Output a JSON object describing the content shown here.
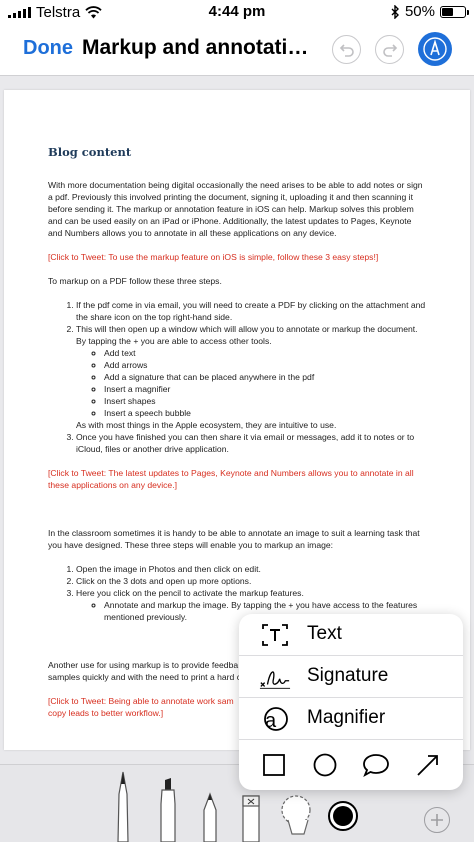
{
  "status_bar": {
    "carrier": "Telstra",
    "time": "4:44 pm",
    "battery": "50%",
    "battery_level": 0.5
  },
  "nav": {
    "done_label": "Done",
    "title": "Markup and annotation..."
  },
  "document": {
    "heading": "Blog content",
    "intro": "With more documentation being digital occasionally the need arises to be able to add notes or sign a pdf. Previously this involved printing the document, signing it, uploading it and then scanning it before sending it. The markup or annotation feature in iOS can help. Markup solves this problem and can be used easily on an iPad or iPhone. Additionally, the latest updates to Pages, Keynote and Numbers allows you to annotate in all these applications on any device.",
    "tweet1": "[Click to Tweet: To use the markup feature on iOS is simple, follow these 3 easy steps!]",
    "pdf_steps_intro": "To markup on a PDF follow these three steps.",
    "pdf_steps": [
      "If the pdf come in via email, you will need to create a PDF by clicking on the attachment and the share icon on the top right-hand side.",
      "This will then open up a window which will allow you to annotate or markup the document. By tapping the + you are able to access other tools.",
      "Once you have finished you can then share it via email or messages, add it to notes or to iCloud, files or another drive application."
    ],
    "tools": [
      "Add text",
      "Add arrows",
      "Add a signature that can be placed anywhere in the pdf",
      "Insert a magnifier",
      "Insert shapes",
      "Insert a speech bubble"
    ],
    "tools_after": "As with most things in the Apple ecosystem, they are intuitive to use.",
    "tweet2": "[Click to Tweet: The latest updates to Pages, Keynote and Numbers allows you to annotate in all these applications on any device.]",
    "classroom_intro": "In the classroom sometimes it is handy to be able to annotate an image to suit a learning task that you have designed. These three steps will enable you to markup an image:",
    "image_steps": [
      "Open the image in Photos and then click on edit.",
      "Click on the 3 dots and open up more options.",
      "Here you click on the pencil to activate the markup features."
    ],
    "image_sub": "Annotate and markup the image. By tapping the + you have access to the features mentioned previously.",
    "another_use": "Another use for using markup is to provide feedba",
    "another_use_2": "samples quickly and with the need to print a hard c",
    "tweet3": "[Click to Tweet: Being able to annotate work sam",
    "tweet3_2": "copy leads to better workflow.]"
  },
  "popup_menu": {
    "items": [
      {
        "label": "Text",
        "icon": "text-box-icon"
      },
      {
        "label": "Signature",
        "icon": "signature-icon"
      },
      {
        "label": "Magnifier",
        "icon": "magnifier-icon"
      }
    ],
    "shapes": [
      "square-icon",
      "circle-icon",
      "speech-bubble-icon",
      "arrow-icon"
    ]
  },
  "toolbar": {
    "tools": [
      "pen-icon",
      "highlighter-icon",
      "pencil-icon",
      "eraser-icon",
      "lasso-icon"
    ],
    "selected_color": "#000000"
  },
  "colors": {
    "accent": "#1e6fd9",
    "tweet_red": "#d72f20",
    "heading_blue": "#1f3b5a"
  }
}
